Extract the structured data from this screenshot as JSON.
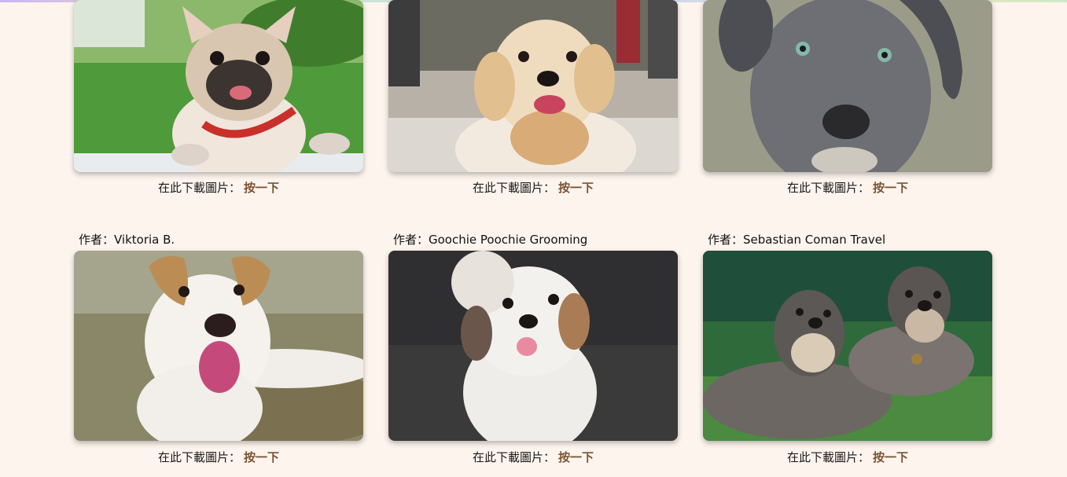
{
  "download": {
    "prefix": "在此下載圖片：",
    "link": "按一下"
  },
  "cards": [
    {
      "author": "",
      "image_alt": "French bulldog with red collar on grass"
    },
    {
      "author": "",
      "image_alt": "Golden retriever puppy on street"
    },
    {
      "author": "",
      "image_alt": "Grey Great Dane puppy portrait"
    },
    {
      "author": "作者：Viktoria B.",
      "image_alt": "White and tan dog lying on grass"
    },
    {
      "author": "作者：Goochie Poochie Grooming",
      "image_alt": "Fluffy white shih tzu on dark background"
    },
    {
      "author": "作者：Sebastian Coman Travel",
      "image_alt": "Two schnauzers lying on grass"
    }
  ],
  "colors": {
    "background": "#fdf4ee",
    "link": "#7a5331"
  }
}
